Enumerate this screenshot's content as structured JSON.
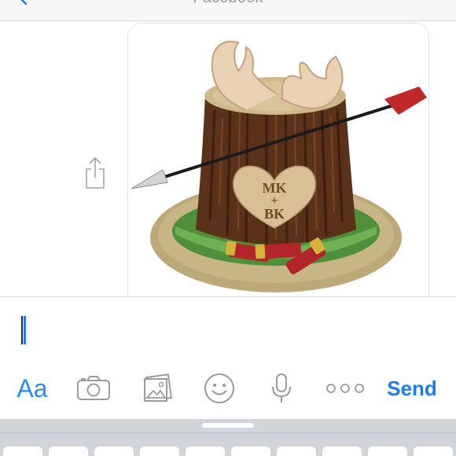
{
  "navbar": {
    "title": "Facebook"
  },
  "thread": {
    "photo": {
      "heart_line1": "MK",
      "heart_line2": "+",
      "heart_line3": "BK"
    }
  },
  "composer": {
    "input_value": "",
    "aa_label": "Aa",
    "send_label": "Send"
  },
  "colors": {
    "accent": "#1c7cf4",
    "icon_gray": "#9b9b9b",
    "keyboard_bg": "#d1d4d9"
  },
  "icons": {
    "back": "chevron-left-icon",
    "share": "share-icon",
    "camera": "camera-icon",
    "gallery": "photo-gallery-icon",
    "emoji": "smiley-icon",
    "mic": "microphone-icon",
    "more": "more-icon"
  }
}
